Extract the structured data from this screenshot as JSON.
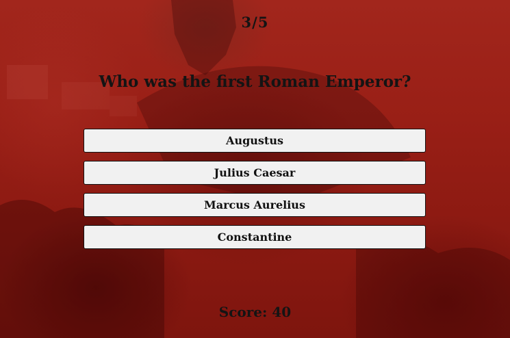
{
  "quiz": {
    "counter": "3/5",
    "question": "Who was the first Roman Emperor?",
    "answers": [
      {
        "label": "Augustus"
      },
      {
        "label": "Julius Caesar"
      },
      {
        "label": "Marcus Aurelius"
      },
      {
        "label": "Constantine"
      }
    ],
    "score_label": "Score: 40"
  },
  "colors": {
    "background_tint": "#9b2118",
    "button_bg": "#f1f1f1",
    "text": "#141414"
  }
}
